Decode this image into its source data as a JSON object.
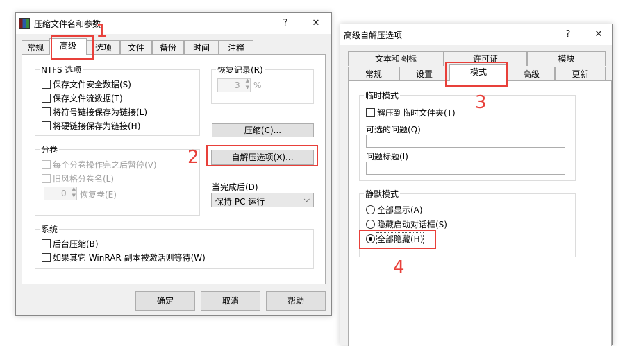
{
  "left_window": {
    "title": "压缩文件名和参数",
    "help_glyph": "?",
    "close_glyph": "✕",
    "tabs": [
      "常规",
      "高级",
      "选项",
      "文件",
      "备份",
      "时间",
      "注释"
    ],
    "ntfs": {
      "title": "NTFS 选项",
      "items": [
        "保存文件安全数据(S)",
        "保存文件流数据(T)",
        "将符号链接保存为链接(L)",
        "将硬链接保存为链接(H)"
      ]
    },
    "recovery": {
      "title": "恢复记录(R)",
      "value": "3",
      "unit": "%"
    },
    "compress_button": "压缩(C)...",
    "sfx_button": "自解压选项(X)...",
    "volumes": {
      "title": "分卷",
      "items": [
        "每个分卷操作完之后暂停(V)",
        "旧风格分卷名(L)"
      ],
      "recovery_value": "0",
      "recovery_label": "恢复卷(E)"
    },
    "on_complete": {
      "label": "当完成后(D)",
      "value": "保持 PC 运行"
    },
    "system": {
      "title": "系统",
      "items": [
        "后台压缩(B)",
        "如果其它 WinRAR 副本被激活则等待(W)"
      ]
    },
    "buttons": {
      "ok": "确定",
      "cancel": "取消",
      "help": "帮助"
    }
  },
  "right_window": {
    "title": "高级自解压选项",
    "help_glyph": "?",
    "close_glyph": "✕",
    "tabs_top": [
      "文本和图标",
      "许可证",
      "模块"
    ],
    "tabs_bottom": [
      "常规",
      "设置",
      "模式",
      "高级",
      "更新"
    ],
    "temp_mode": {
      "title": "临时模式",
      "checkbox": "解压到临时文件夹(T)",
      "optional_question_label": "可选的问题(Q)",
      "question_title_label": "问题标题(I)"
    },
    "silent_mode": {
      "title": "静默模式",
      "options": [
        "全部显示(A)",
        "隐藏启动对话框(S)",
        "全部隐藏(H)"
      ],
      "selected": 2
    }
  },
  "annotations": [
    "1",
    "2",
    "3",
    "4"
  ],
  "colors": {
    "highlight": "#e8403a",
    "window_bg": "#f0f0f0"
  },
  "icons": [
    "winrar-logo-icon",
    "spin-up-icon",
    "spin-down-icon",
    "chevron-down-icon"
  ]
}
